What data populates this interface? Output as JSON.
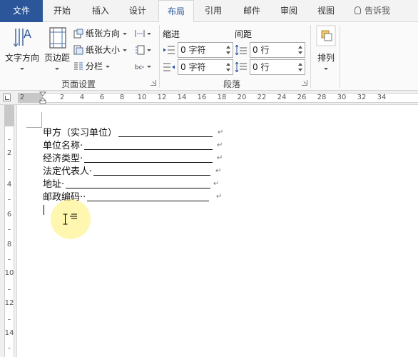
{
  "tabs": [
    {
      "label": "文件",
      "name": "tab-file"
    },
    {
      "label": "开始",
      "name": "tab-home"
    },
    {
      "label": "插入",
      "name": "tab-insert"
    },
    {
      "label": "设计",
      "name": "tab-design"
    },
    {
      "label": "布局",
      "name": "tab-layout"
    },
    {
      "label": "引用",
      "name": "tab-references"
    },
    {
      "label": "邮件",
      "name": "tab-mailings"
    },
    {
      "label": "审阅",
      "name": "tab-review"
    },
    {
      "label": "视图",
      "name": "tab-view"
    }
  ],
  "tell_me": "告诉我",
  "ribbon": {
    "page_setup": {
      "text_direction": "文字方向",
      "margins": "页边距",
      "orientation": "纸张方向",
      "size": "纸张大小",
      "columns": "分栏",
      "group_label": "页面设置"
    },
    "paragraph": {
      "indent_label": "缩进",
      "spacing_label": "间距",
      "indent_left": "0 字符",
      "indent_right": "0 字符",
      "spacing_before": "0 行",
      "spacing_after": "0 行",
      "group_label": "段落"
    },
    "arrange": {
      "label": "排列"
    }
  },
  "ruler": {
    "h_numbers": [
      "2",
      "2",
      "4",
      "6",
      "8",
      "10",
      "12",
      "14",
      "16",
      "18",
      "20",
      "22",
      "24",
      "26",
      "28",
      "30",
      "32",
      "34"
    ],
    "v_numbers": [
      "2",
      "4",
      "6",
      "8",
      "10",
      "12",
      "14"
    ]
  },
  "document": {
    "lines": [
      "甲方（实习单位）",
      "单位名称·",
      "经济类型·",
      "法定代表人·",
      "地址·",
      "邮政编码··"
    ]
  },
  "colors": {
    "file_tab": "#2b579a",
    "active_tab_text": "#2b579a",
    "cursor_highlight": "#fff06e"
  }
}
